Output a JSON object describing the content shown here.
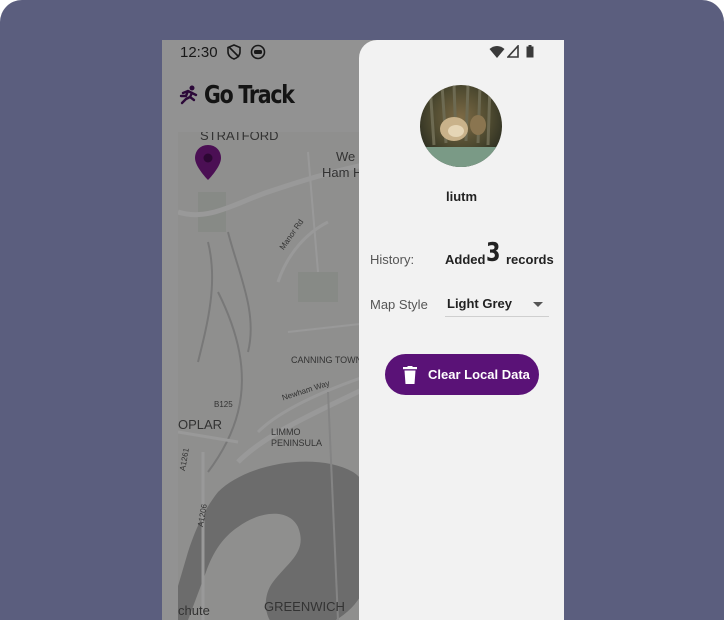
{
  "status_bar": {
    "time": "12:30"
  },
  "app": {
    "title": "Go Track"
  },
  "map": {
    "labels": {
      "stratford": "STRATFORD",
      "west_ham": "West Ham",
      "west_ham_a": "We",
      "west_ham_b": "Ham H",
      "manor_rd": "Manor Rd",
      "canning_town": "CANNING TOWN",
      "newham_way": "Newham Way",
      "b125": "B125",
      "poplar": "OPLAR",
      "limmo": "LIMMO",
      "peninsula": "PENINSULA",
      "a1261": "A1261",
      "a1206": "A1206",
      "chute": "chute",
      "greenwich": "GREENWICH"
    },
    "marker_color": "#7d1a8c"
  },
  "drawer": {
    "username": "liutm",
    "history_label": "History:",
    "history_added": "Added",
    "history_count": "3",
    "history_records": "records",
    "map_style_label": "Map Style",
    "map_style_value": "Light Grey",
    "clear_button_label": "Clear Local Data",
    "clear_button_color": "#5a1277"
  },
  "icons": {
    "status_left": [
      "shield-icon",
      "sync-icon"
    ],
    "status_right": [
      "wifi-icon",
      "signal-icon",
      "battery-icon"
    ],
    "logo": "running-figure-icon",
    "clear": "trash-icon",
    "select": "caret-down-icon"
  }
}
